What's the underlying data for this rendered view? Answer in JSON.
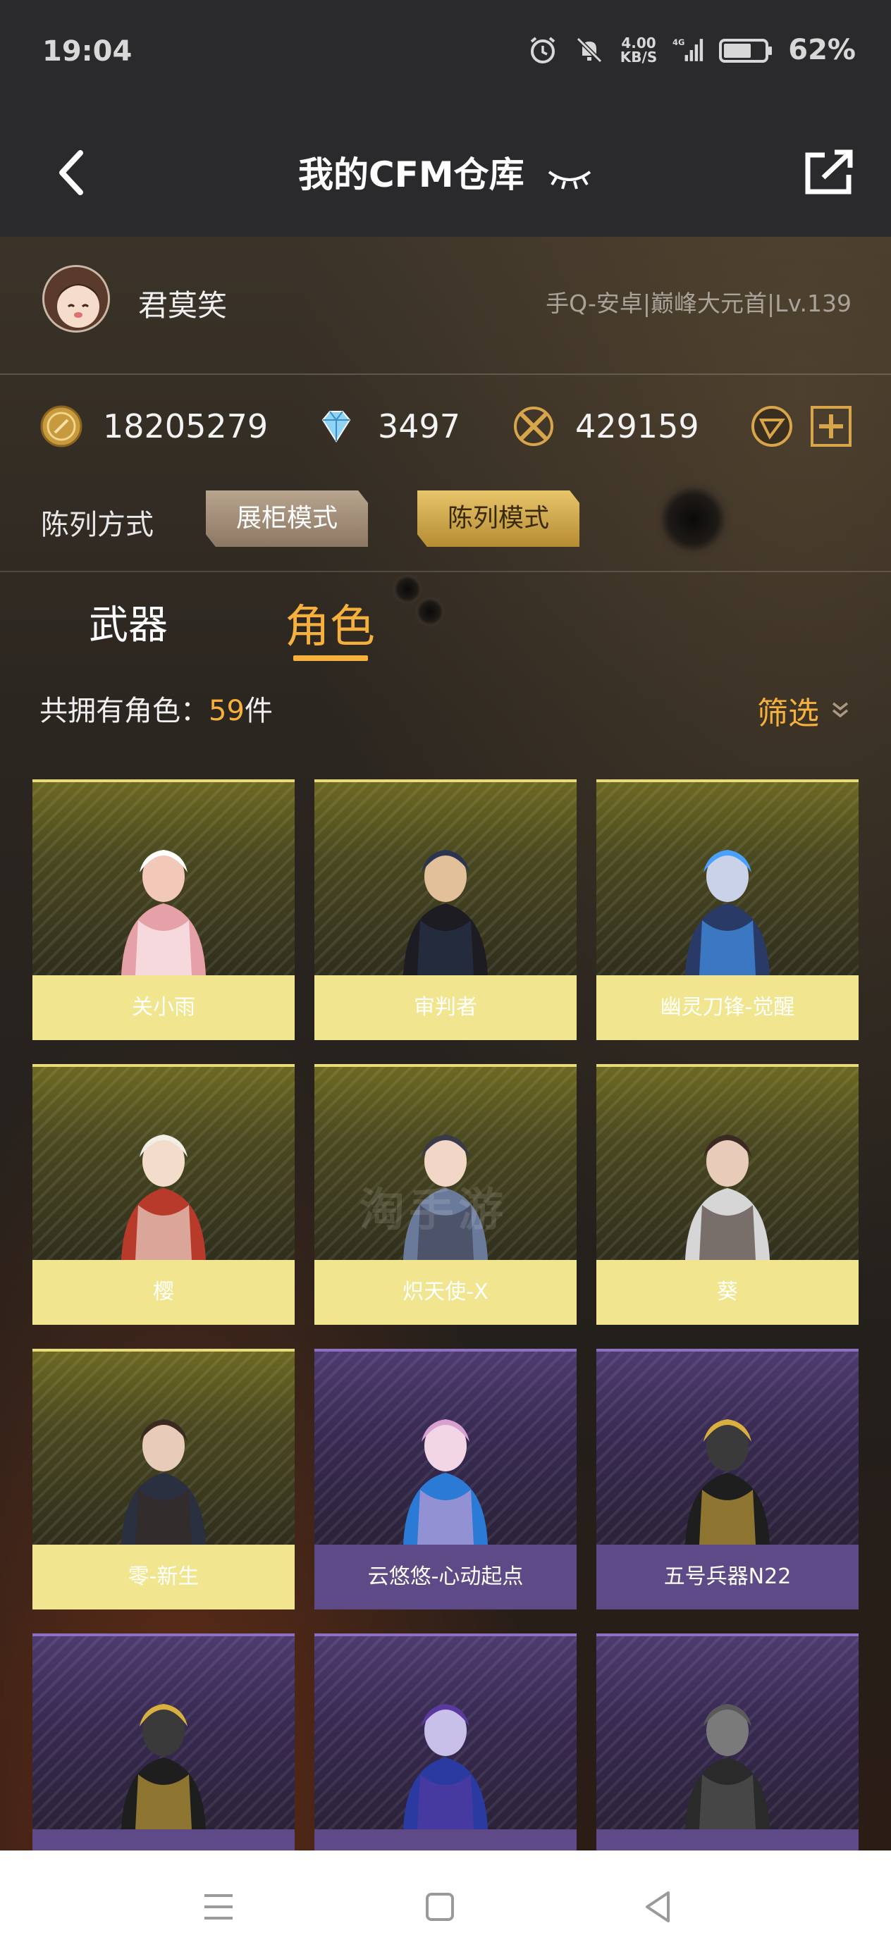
{
  "status_bar": {
    "time": "19:04",
    "net_speed": "4.00",
    "net_unit": "KB/S",
    "signal": "4G",
    "battery": "62%"
  },
  "header": {
    "title": "我的CFM仓库",
    "back_icon": "back-arrow-icon",
    "eye_icon": "eye-closed-icon",
    "share_icon": "share-icon"
  },
  "profile": {
    "nickname": "君莫笑",
    "server": "手Q-安卓|巅峰大元首|Lv.139"
  },
  "currency": {
    "gold": "18205279",
    "diamond": "3497",
    "points": "429159"
  },
  "display_mode": {
    "label": "陈列方式",
    "cabinet": "展柜模式",
    "list": "陈列模式"
  },
  "tabs": {
    "weapons": "武器",
    "roles": "角色",
    "active": "roles"
  },
  "summary": {
    "prefix": "共拥有角色：",
    "count": "59",
    "suffix": "件",
    "filter": "筛选"
  },
  "watermark": "淘手游",
  "characters": [
    {
      "name": "关小雨",
      "rarity": "gold"
    },
    {
      "name": "审判者",
      "rarity": "gold"
    },
    {
      "name": "幽灵刀锋-觉醒",
      "rarity": "gold"
    },
    {
      "name": "樱",
      "rarity": "gold"
    },
    {
      "name": "炽天使-X",
      "rarity": "gold"
    },
    {
      "name": "葵",
      "rarity": "gold"
    },
    {
      "name": "零-新生",
      "rarity": "gold"
    },
    {
      "name": "云悠悠-心动起点",
      "rarity": "purple"
    },
    {
      "name": "五号兵器N22",
      "rarity": "purple"
    },
    {
      "name": "",
      "rarity": "purple"
    },
    {
      "name": "",
      "rarity": "purple"
    },
    {
      "name": "",
      "rarity": "purple"
    }
  ],
  "colors": {
    "accent": "#f6b13c",
    "gold_card": "#f1e68f",
    "purple_card": "#5e4a86",
    "header_bg": "#2a2a2d"
  }
}
